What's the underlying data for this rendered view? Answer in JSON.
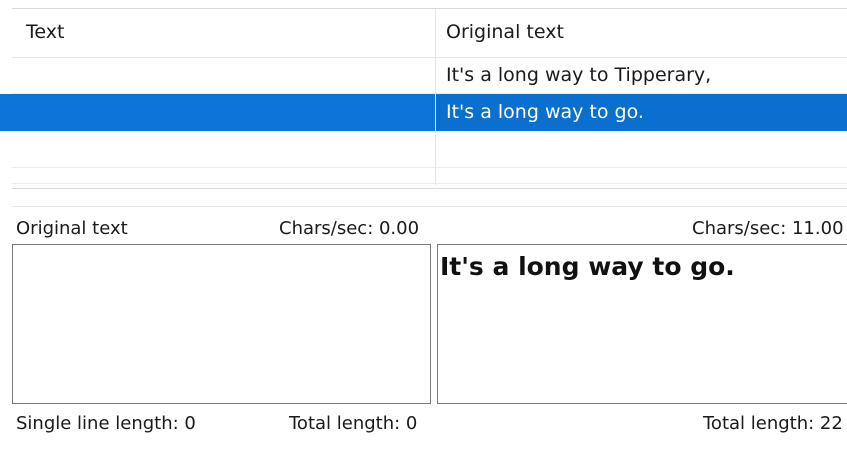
{
  "grid": {
    "headers": {
      "text": "Text",
      "original": "Original text"
    },
    "rows": [
      {
        "text": "",
        "original": "It's a long way to Tipperary,"
      },
      {
        "text": "",
        "original": "It's a long way to go.",
        "selected": true
      },
      {
        "text": "",
        "original": ""
      },
      {
        "text": "",
        "original": ""
      }
    ]
  },
  "editor": {
    "left_label": "Original text",
    "left_chars_sec": "Chars/sec: 0.00",
    "right_chars_sec": "Chars/sec: 11.00",
    "left_value": "",
    "right_preview": "It's a long way to go.",
    "single_line_length": "Single line length: 0",
    "left_total_length": "Total length: 0",
    "right_total_length": "Total length: 22"
  },
  "colors": {
    "selection": "#0b74d6",
    "border": "#7a7a7a"
  }
}
